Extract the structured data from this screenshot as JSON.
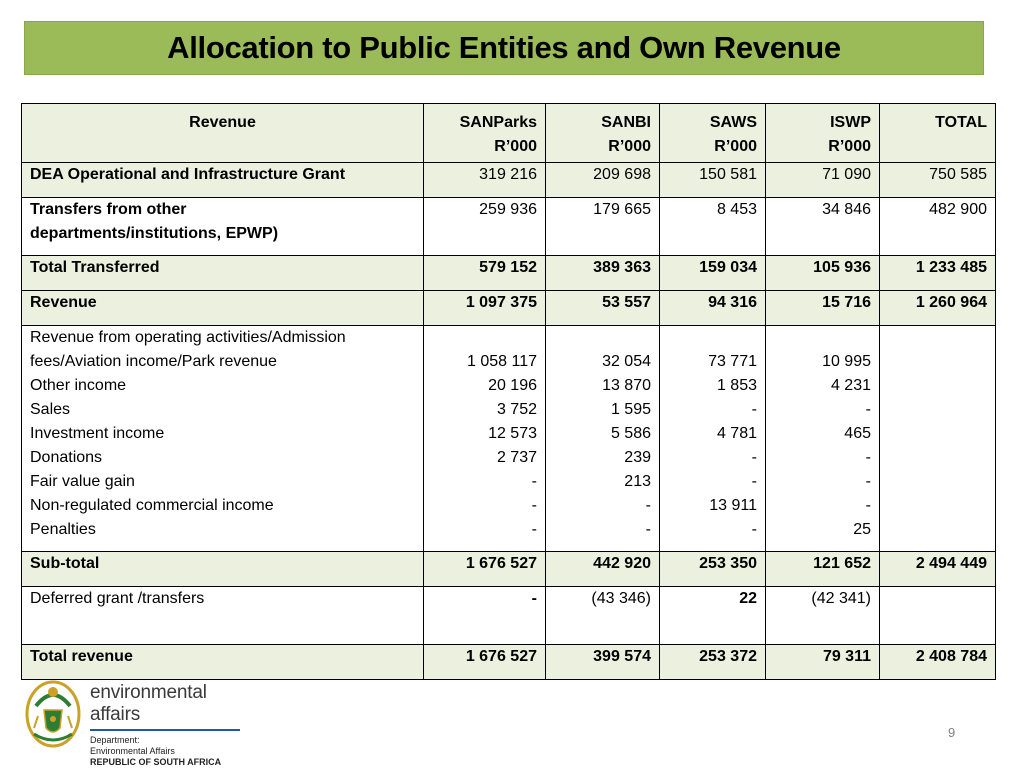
{
  "title": "Allocation to Public Entities and Own Revenue",
  "table": {
    "header": {
      "label": "Revenue",
      "cols": [
        {
          "name": "SANParks",
          "unit": "R’000"
        },
        {
          "name": "SANBI",
          "unit": "R’000"
        },
        {
          "name": "SAWS",
          "unit": "R’000"
        },
        {
          "name": "ISWP",
          "unit": "R’000"
        },
        {
          "name": "TOTAL",
          "unit": ""
        }
      ]
    },
    "rows": {
      "dea": {
        "label": "DEA Operational and Infrastructure Grant",
        "values": [
          "319 216",
          "209 698",
          "150 581",
          "71 090",
          "750 585"
        ]
      },
      "transfers": {
        "label_lines": [
          "Transfers from other",
          "departments/institutions, EPWP)"
        ],
        "values": [
          "259 936",
          "179 665",
          "8 453",
          "34 846",
          "482 900"
        ]
      },
      "total_transferred": {
        "label": "Total Transferred",
        "values": [
          "579 152",
          "389 363",
          "159 034",
          "105 936",
          "1 233 485"
        ]
      },
      "revenue": {
        "label": "Revenue",
        "values": [
          "1 097 375",
          "53 557",
          "94 316",
          "15 716",
          "1 260 964"
        ]
      },
      "breakdown": {
        "label_lines": [
          "Revenue from operating activities/Admission",
          "fees/Aviation income/Park revenue",
          "Other income",
          "Sales",
          "Investment income",
          "Donations",
          "Fair value gain",
          "Non-regulated commercial income",
          "Penalties"
        ],
        "cols": [
          [
            "",
            "1 058 117",
            "20 196",
            "3 752",
            "12 573",
            "2 737",
            "-",
            "-",
            "-"
          ],
          [
            "",
            "32 054",
            "13 870",
            "1 595",
            "5 586",
            "239",
            "213",
            "-",
            "-"
          ],
          [
            "",
            "73 771",
            "1 853",
            "-",
            "4 781",
            "-",
            "-",
            "13 911",
            "-"
          ],
          [
            "",
            "10 995",
            "4 231",
            "-",
            "465",
            "-",
            "-",
            "-",
            "25"
          ],
          [
            "",
            "",
            "",
            "",
            "",
            "",
            "",
            "",
            ""
          ]
        ]
      },
      "subtotal": {
        "label": "Sub-total",
        "values": [
          "1 676 527",
          "442 920",
          "253 350",
          "121 652",
          "2 494 449"
        ]
      },
      "deferred": {
        "label": "Deferred grant /transfers",
        "values": [
          "-",
          "(43 346)",
          "22",
          "(42 341)",
          ""
        ]
      },
      "total_revenue": {
        "label": "Total revenue",
        "values": [
          "1 676 527",
          "399 574",
          "253 372",
          "79 311",
          "2 408 784"
        ]
      }
    }
  },
  "logo": {
    "name": "environmental affairs",
    "sub_lines": [
      "Department:",
      "Environmental Affairs"
    ],
    "country": "REPUBLIC OF SOUTH AFRICA",
    "colors": {
      "green": "#2e7d32",
      "gold": "#c9a227",
      "blue": "#1c5ba8"
    }
  },
  "page_number": "9",
  "colors": {
    "title_bg": "#9bbb59",
    "row_shade": "#ebf1de"
  }
}
